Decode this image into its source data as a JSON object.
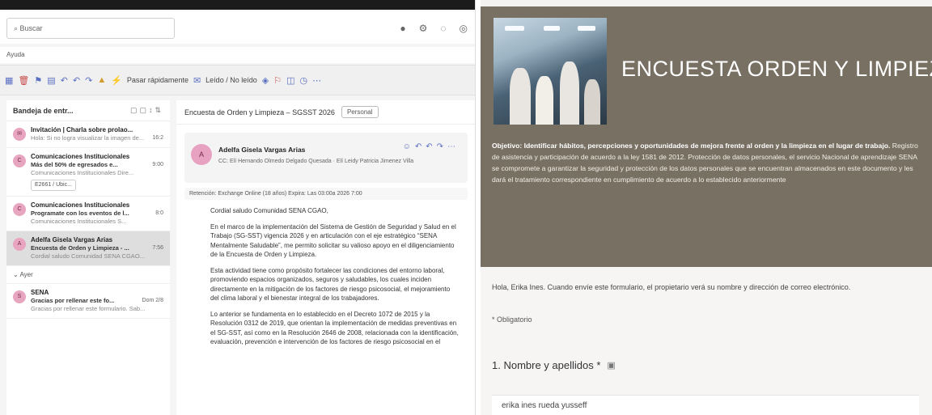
{
  "mail": {
    "search_placeholder": "Buscar",
    "menu_label": "Ayuda",
    "ribbon": {
      "item1": "Pasar rápidamente",
      "item2": "Leído / No leído"
    },
    "list": {
      "header": "Bandeja de entr...",
      "items": [
        {
          "sender": "Invitación | Charla sobre prolao...",
          "preview": "Hola: Si no logra visualizar la imagen de...",
          "date": "16:2",
          "avatar": "✉"
        },
        {
          "sender": "Comunicaciones Institucionales",
          "subject": "Más del 50% de egresados e...",
          "preview": "Comunicaciones Institucionales Dire...",
          "date": "9:00",
          "chip": "E2661 / Ubic...",
          "avatar": "C"
        },
        {
          "sender": "Comunicaciones Institucionales",
          "subject": "Programate con los eventos de l...",
          "preview": "Comunicaciones Institucionales S...",
          "date": "8:0",
          "avatar": "C"
        },
        {
          "sender": "Adelfa Gisela Vargas Arias",
          "subject": "Encuesta de Orden y Limpieza - ...",
          "preview": "Cordial saludo Comunidad SENA CGAO...",
          "date": "7:56",
          "avatar": "A"
        },
        {
          "sender": "SENA",
          "subject": "Gracias por rellenar este fo...",
          "preview": "Gracias por rellenar este formulario. Sab...",
          "date": "Dom 2/8",
          "avatar": "S"
        }
      ],
      "group_label": "Ayer"
    },
    "reader": {
      "title": "Encuesta de Orden y Limpieza – SGSST 2026",
      "tag": "Personal",
      "sender_name": "Adelfa Gisela Vargas Arias",
      "cc": "CC: Elí Hernando Olmedo Delgado Quesada · Elí Leidy Patricia Jimenez Villa",
      "notice": "Retención: Exchange Online (18 años) Expira: Las 03:00a 2026 7:00",
      "paragraphs": [
        "Cordial saludo Comunidad SENA CGAO,",
        "En el marco de la implementación del Sistema de Gestión de Seguridad y Salud en el Trabajo (SG-SST) vigencia 2026 y en articulación con el eje estratégico “SENA Mentalmente Saludable”, me permito solicitar su valioso apoyo en el diligenciamiento de la Encuesta de Orden y Limpieza.",
        "Esta actividad tiene como propósito fortalecer las condiciones del entorno laboral, promoviendo espacios organizados, seguros y saludables, los cuales inciden directamente en la mitigación de los factores de riesgo psicosocial, el mejoramiento del clima laboral y el bienestar integral de los trabajadores.",
        "Lo anterior se fundamenta en lo establecido en el Decreto 1072 de 2015 y la Resolución 0312 de 2019, que orientan la implementación de medidas preventivas en el SG-SST, así como en la Resolución 2646 de 2008, relacionada con la identificación, evaluación, prevención e intervención de los factores de riesgo psicosocial en el"
      ]
    }
  },
  "form": {
    "title": "ENCUESTA ORDEN Y LIMPIEZA",
    "objective_bold": "Objetivo: Identificar hábitos, percepciones y oportunidades de mejora frente al orden y la limpieza en el lugar de trabajo.",
    "objective_text": "Registro de asistencia y participación de acuerdo a la ley 1581 de 2012. Protección de datos personales, el servicio Nacional de aprendizaje SENA se compromete a garantizar la seguridad y protección de los datos personales que se encuentran almacenados en este documento y les dará el tratamiento correspondiente en cumplimiento de acuerdo a lo establecido anteriormente",
    "greeting": "Hola, Erika Ines. Cuando envíe este formulario, el propietario verá su nombre y dirección de correo electrónico.",
    "required_note": "* Obligatorio",
    "question1": "1. Nombre y apellidos *",
    "answer1": "erika ines rueda yusseff"
  }
}
